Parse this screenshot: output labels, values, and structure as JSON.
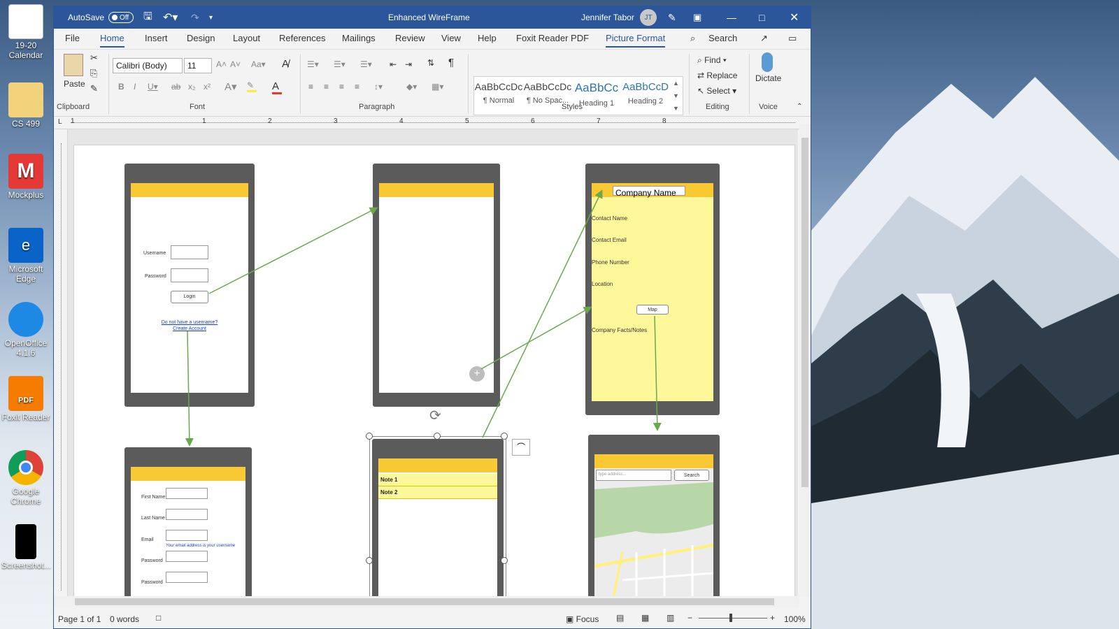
{
  "desktop": {
    "icons": [
      {
        "label": "19-20 Calendar",
        "icon": "calendar-file-icon"
      },
      {
        "label": "CS 499",
        "icon": "folder-icon"
      },
      {
        "label": "Mockplus",
        "icon": "mockplus-icon"
      },
      {
        "label": "Microsoft Edge",
        "icon": "edge-icon"
      },
      {
        "label": "OpenOffice 4.1.6",
        "icon": "openoffice-icon"
      },
      {
        "label": "Foxit Reader",
        "icon": "foxit-icon"
      },
      {
        "label": "Google Chrome",
        "icon": "chrome-icon"
      },
      {
        "label": "Screenshot...",
        "icon": "screenshot-file-icon"
      }
    ]
  },
  "titlebar": {
    "autosave_label": "AutoSave",
    "autosave_state": "Off",
    "doc_title": "Enhanced WireFrame",
    "user_name": "Jennifer Tabor",
    "user_initials": "JT"
  },
  "menu": {
    "tabs": [
      "File",
      "Home",
      "Insert",
      "Design",
      "Layout",
      "References",
      "Mailings",
      "Review",
      "View",
      "Help",
      "Foxit Reader PDF",
      "Picture Format"
    ],
    "search_label": "Search"
  },
  "ribbon": {
    "clipboard": {
      "paste": "Paste",
      "label": "Clipboard"
    },
    "font": {
      "name": "Calibri (Body)",
      "size": "11",
      "label": "Font"
    },
    "paragraph_label": "Paragraph",
    "styles": {
      "label": "Styles",
      "items": [
        {
          "preview": "AaBbCcDc",
          "name": "¶ Normal"
        },
        {
          "preview": "AaBbCcDc",
          "name": "¶ No Spac..."
        },
        {
          "preview": "AaBbCc",
          "name": "Heading 1"
        },
        {
          "preview": "AaBbCcD",
          "name": "Heading 2"
        }
      ]
    },
    "editing": {
      "find": "Find",
      "replace": "Replace",
      "select": "Select",
      "label": "Editing"
    },
    "voice": {
      "dictate": "Dictate",
      "label": "Voice"
    }
  },
  "ruler": {
    "marks": [
      "1",
      "1",
      "2",
      "3",
      "4",
      "5",
      "6",
      "7",
      "8"
    ]
  },
  "wireframe": {
    "login": {
      "username": "Username",
      "password": "Password",
      "login_btn": "Login",
      "link1": "Do not have a username?",
      "link2": "Create Account"
    },
    "company": {
      "name_placeholder": "Company Name",
      "contact_name": "Contact Name",
      "contact_email": "Contact Email",
      "phone": "Phone Number",
      "location": "Location",
      "map_btn": "Map",
      "facts": "Company Facts/Notes"
    },
    "register": {
      "first": "First Name",
      "last": "Last Name",
      "email": "Email",
      "email_hint": "Your email address is your username",
      "password": "Password",
      "password2": "Password"
    },
    "notes": {
      "note1": "Note 1",
      "note2": "Note 2"
    },
    "map": {
      "placeholder": "type address...",
      "search_btn": "Search"
    }
  },
  "status": {
    "page": "Page 1 of 1",
    "words": "0 words",
    "focus": "Focus",
    "zoom": "100%"
  }
}
